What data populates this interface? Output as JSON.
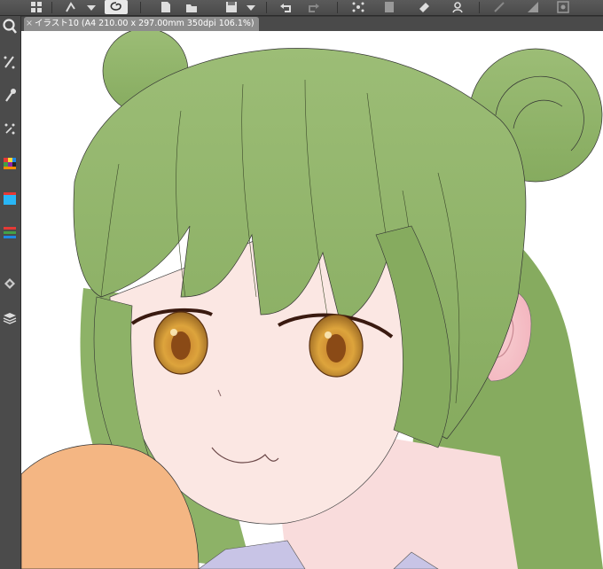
{
  "document_tab": {
    "title": "イラスト10 (A4 210.00 x 297.00mm 350dpi 106.1%)",
    "close_glyph": "×"
  },
  "toolbar": {
    "icons": [
      "grid-icon",
      "transform-icon",
      "lasso-icon",
      "new-page-icon",
      "open-folder-icon",
      "save-icon",
      "undo-icon",
      "redo-icon",
      "fill-icon",
      "copy-icon",
      "tag-icon",
      "person-icon",
      "ruler-icon",
      "gradient-icon",
      "settings-icon"
    ]
  },
  "left_toolbar": {
    "icons": [
      "zoom-icon",
      "pen-icon",
      "eyedropper-icon",
      "selection-icon",
      "color-grid-icon",
      "color-picker-icon",
      "color-slider-icon",
      "layer-texture-icon",
      "layers-icon"
    ]
  },
  "colors": {
    "hair": "#8fb468",
    "hair_dark": "#7aa156",
    "skin": "#fbe6e2",
    "eye": "#d9a23a",
    "hand": "#f4b683",
    "collar": "#c8c4e6"
  }
}
